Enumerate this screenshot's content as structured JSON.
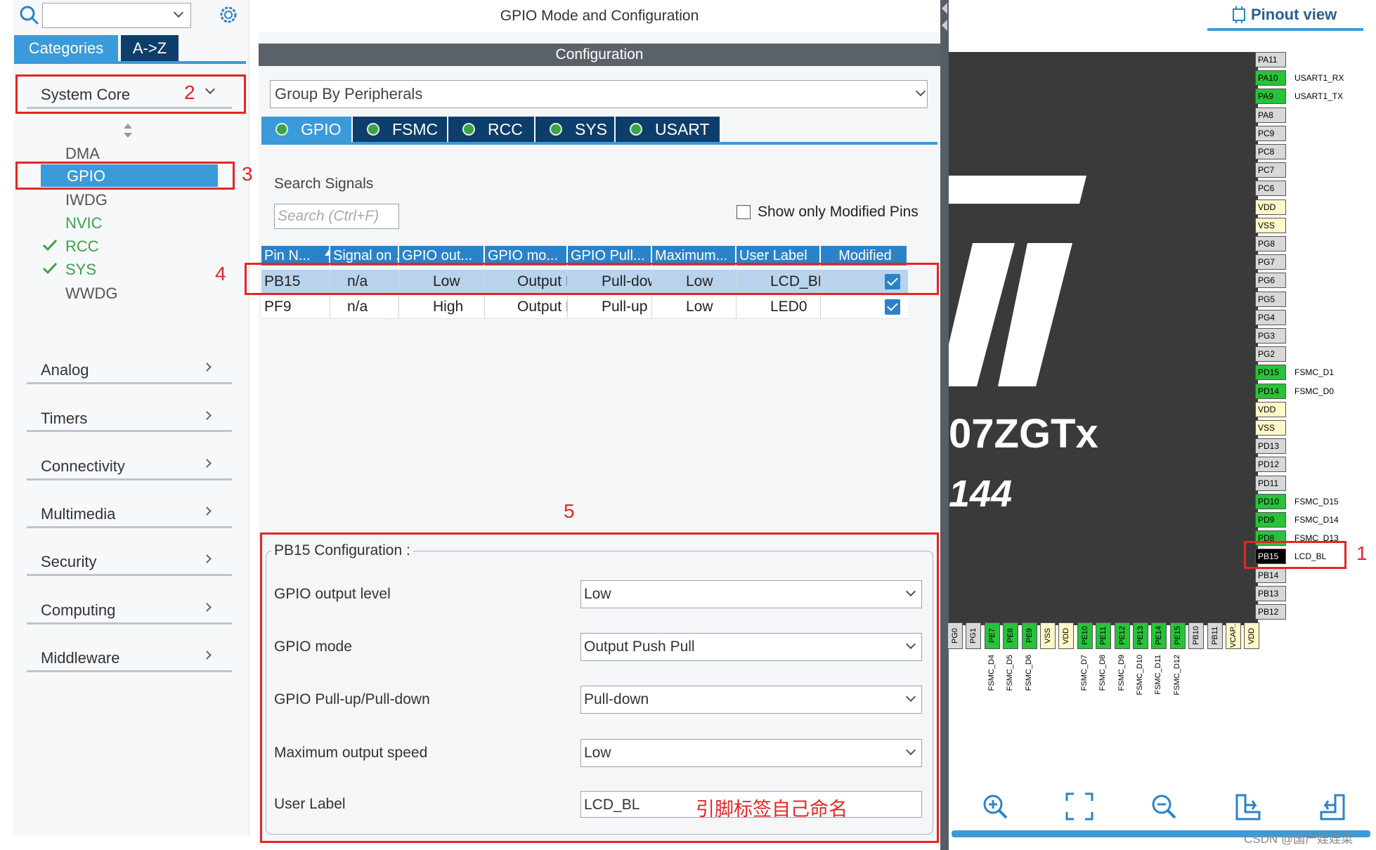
{
  "left_panel": {
    "search_value": "",
    "tabs": [
      {
        "label": "Categories",
        "active": true
      },
      {
        "label": "A->Z",
        "active": false
      }
    ],
    "system_core": "System Core",
    "sub_items": [
      "DMA",
      "GPIO",
      "IWDG",
      "NVIC",
      "RCC",
      "SYS",
      "WWDG"
    ],
    "groups": [
      "Analog",
      "Timers",
      "Connectivity",
      "Multimedia",
      "Security",
      "Computing",
      "Middleware"
    ]
  },
  "center": {
    "title": "GPIO Mode and Configuration",
    "config_bar": "Configuration",
    "group_by": "Group By Peripherals",
    "peripheral_tabs": [
      "GPIO",
      "FSMC",
      "RCC",
      "SYS",
      "USART"
    ],
    "search_label": "Search Signals",
    "search_placeholder": "Search (Ctrl+F)",
    "show_modified": "Show only Modified Pins",
    "columns": [
      "Pin N...",
      "Signal on ...",
      "GPIO out...",
      "GPIO mo...",
      "GPIO Pull...",
      "Maximum...",
      "User Label",
      "Modified"
    ],
    "rows": [
      {
        "pin": "PB15",
        "signal": "n/a",
        "out": "Low",
        "mode": "Output P...",
        "pull": "Pull-down",
        "max": "Low",
        "label": "LCD_BL",
        "modified": true
      },
      {
        "pin": "PF9",
        "signal": "n/a",
        "out": "High",
        "mode": "Output P...",
        "pull": "Pull-up",
        "max": "Low",
        "label": "LED0",
        "modified": true
      }
    ],
    "pb_config_title": "PB15 Configuration :",
    "config": [
      {
        "label": "GPIO output level",
        "value": "Low"
      },
      {
        "label": "GPIO mode",
        "value": "Output Push Pull"
      },
      {
        "label": "GPIO Pull-up/Pull-down",
        "value": "Pull-down"
      },
      {
        "label": "Maximum output speed",
        "value": "Low"
      },
      {
        "label": "User Label",
        "value": "LCD_BL"
      }
    ],
    "annotation_cn": "引脚标签自己命名"
  },
  "annotations": [
    "1",
    "2",
    "3",
    "4",
    "5"
  ],
  "right": {
    "title": "Pinout view",
    "chip_text_1": "07ZGTx",
    "chip_text_2": "144",
    "right_pins": [
      "PA11",
      "PA10",
      "PA9",
      "PA8",
      "PC9",
      "PC8",
      "PC7",
      "PC6",
      "VDD",
      "VSS",
      "PG8",
      "PG7",
      "PG6",
      "PG5",
      "PG4",
      "PG3",
      "PG2",
      "PD15",
      "PD14",
      "VDD",
      "VSS",
      "PD13",
      "PD12",
      "PD11",
      "PD10",
      "PD9",
      "PD8",
      "PB15",
      "PB14",
      "PB13",
      "PB12"
    ],
    "right_pin_labels": {
      "PA10": "USART1_RX",
      "PA9": "USART1_TX",
      "PD15": "FSMC_D1",
      "PD14": "FSMC_D0",
      "PD10": "FSMC_D15",
      "PD9": "FSMC_D14",
      "PD8": "FSMC_D13",
      "PB15": "LCD_BL"
    },
    "bottom_pins": [
      "PG0",
      "PG1",
      "PE7",
      "PE8",
      "PE9",
      "VSS",
      "VDD",
      "PE10",
      "PE11",
      "PE12",
      "PE13",
      "PE14",
      "PE15",
      "PB10",
      "PB11",
      "VCAP..",
      "VDD"
    ],
    "bottom_pin_labels": {
      "PE7": "FSMC_D4",
      "PE8": "FSMC_D5",
      "PE9": "FSMC_D6",
      "PE10": "FSMC_D7",
      "PE11": "FSMC_D8",
      "PE12": "FSMC_D9",
      "PE13": "FSMC_D10",
      "PE14": "FSMC_D11",
      "PE15": "FSMC_D12"
    },
    "watermark": "CSDN @国产娃娃菜",
    "colors": {
      "green": "#29c23a",
      "yellow": "#fff8c8",
      "gray": "#d8d8d8",
      "black": "#000000"
    }
  }
}
